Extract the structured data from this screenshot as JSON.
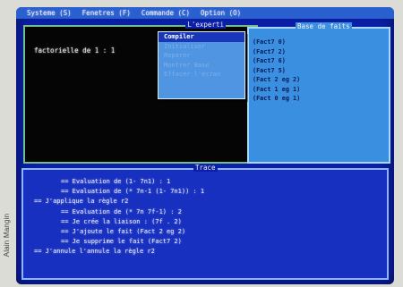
{
  "credit": "Alain Mangin",
  "menubar": {
    "items": [
      "Systeme (S)",
      "Fenetres (F)",
      "Commande (C)",
      "Option (O)"
    ]
  },
  "main_window": {
    "title": "L'experti",
    "output": "factorielle de 1 : 1"
  },
  "facts_window": {
    "title": "Base de faits",
    "facts": [
      "(Fact7 0)",
      "(Fact7 2)",
      "(Fact7 6)",
      "(Fact7 5)",
      "(Fact 2 eg 2)",
      "(Fact 1 eg 1)",
      "(Fact 0 eg 1)"
    ]
  },
  "dropdown": {
    "items": [
      "Compiler",
      "Initialiser",
      "Reparer",
      "Montrer Base",
      "Effacer l'ecran"
    ],
    "active_index": 0
  },
  "trace_window": {
    "title": "Trace",
    "lines": [
      {
        "level": 1,
        "text": "== Evaluation de (1- 7n1) : 1"
      },
      {
        "level": 1,
        "text": "== Evaluation de (* 7n-1 (1- 7n1)) : 1"
      },
      {
        "level": 0,
        "text": "== J'applique la règle r2"
      },
      {
        "level": 1,
        "text": "== Evaluation de (* 7n 7f-1) : 2"
      },
      {
        "level": 1,
        "text": "== Je crée la liaison : (7f . 2)"
      },
      {
        "level": 1,
        "text": "== J'ajoute le fait (Fact 2 eg 2)"
      },
      {
        "level": 1,
        "text": "== Je supprime le fait (Fact7 2)"
      },
      {
        "level": 0,
        "text": "== J'annule l'annule la règle r2"
      }
    ]
  },
  "colors": {
    "screen_bg": "#0b1fa8",
    "menubar": "#2a5fd0",
    "facts_bg": "#3b8fe0",
    "trace_bg": "#1730c0",
    "main_bg": "#050505"
  }
}
